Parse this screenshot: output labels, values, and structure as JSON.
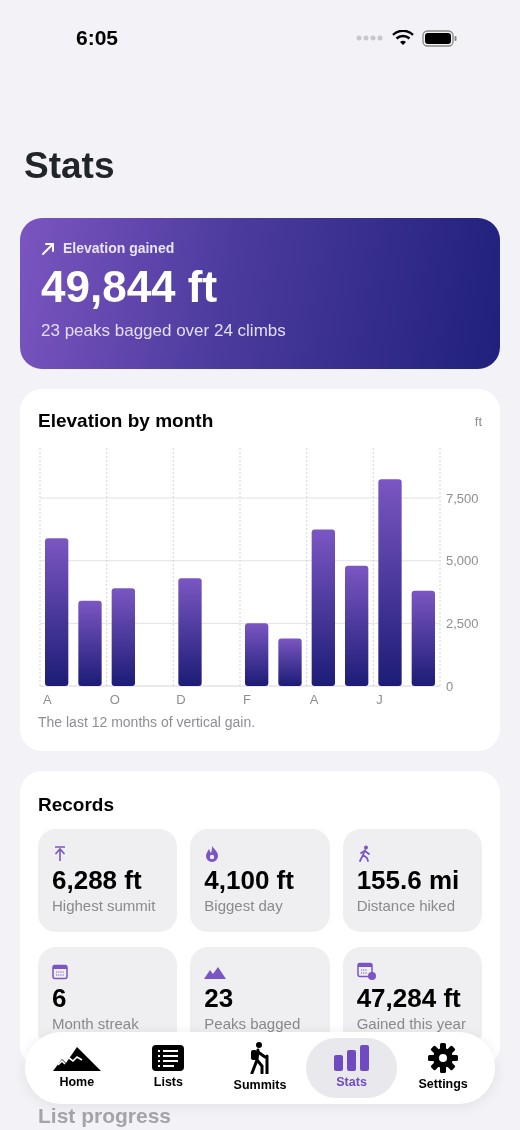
{
  "status_bar": {
    "time": "6:05"
  },
  "title": "Stats",
  "hero": {
    "label": "Elevation gained",
    "value": "49,844 ft",
    "subtitle": "23 peaks bagged over 24 climbs"
  },
  "chart_card": {
    "title": "Elevation by month",
    "unit": "ft",
    "caption": "The last 12 months of vertical gain.",
    "chart_data": {
      "type": "bar",
      "categories": [
        "A",
        null,
        "O",
        null,
        "D",
        null,
        "F",
        null,
        "A",
        null,
        "J",
        null
      ],
      "series": [
        {
          "color": "#7b56c2",
          "values": [
            5900,
            3400,
            3900,
            0,
            4300,
            0,
            2500,
            1900,
            6250,
            4800,
            8250,
            3800
          ]
        }
      ],
      "yticks": [
        {
          "value": 0,
          "label": "0"
        },
        {
          "value": 2500,
          "label": "2,500"
        },
        {
          "value": 5000,
          "label": "5,000"
        },
        {
          "value": 7500,
          "label": "7,500"
        }
      ],
      "ylim": [
        0,
        9500
      ],
      "grid": true
    }
  },
  "records": {
    "title": "Records",
    "items": [
      {
        "kind": "arrow",
        "value": "6,288 ft",
        "label": "Highest summit"
      },
      {
        "kind": "flame",
        "value": "4,100 ft",
        "label": "Biggest day"
      },
      {
        "kind": "walker",
        "value": "155.6 mi",
        "label": "Distance hiked"
      },
      {
        "kind": "calendar",
        "value": "6",
        "label": "Month streak"
      },
      {
        "kind": "mountains",
        "value": "23",
        "label": "Peaks bagged"
      },
      {
        "kind": "calcheck",
        "value": "47,284 ft",
        "label": "Gained this year"
      }
    ]
  },
  "next_section": {
    "title": "List progress"
  },
  "tab_bar": [
    {
      "kind": "mountains",
      "label": "Home",
      "selected": false
    },
    {
      "kind": "list",
      "label": "Lists",
      "selected": false
    },
    {
      "kind": "hiker",
      "label": "Summits",
      "selected": false
    },
    {
      "kind": "bars",
      "label": "Stats",
      "selected": true
    },
    {
      "kind": "gear",
      "label": "Settings",
      "selected": false
    }
  ]
}
